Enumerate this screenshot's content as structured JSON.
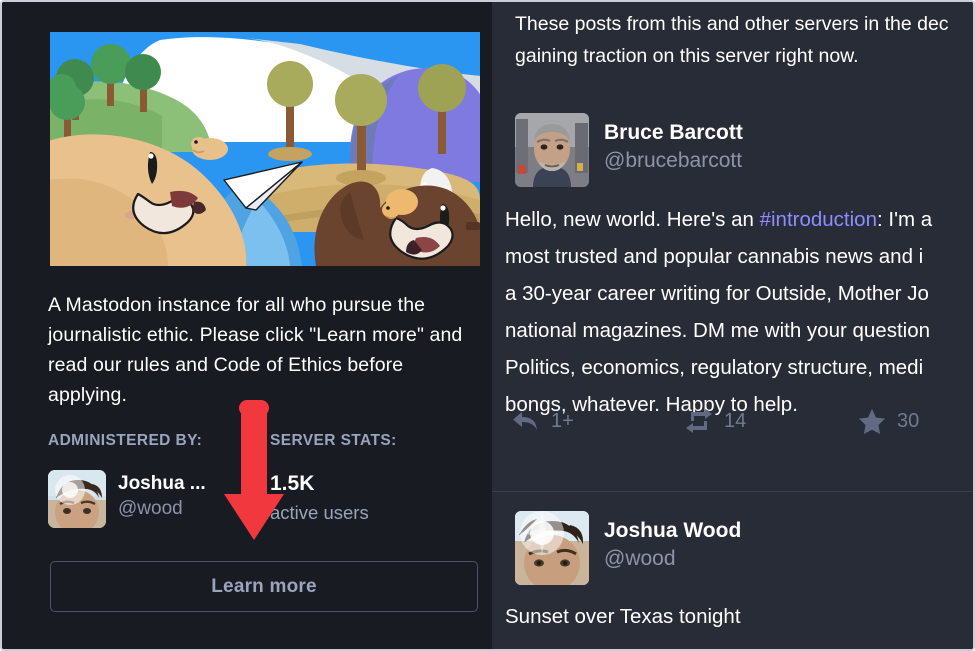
{
  "left_panel": {
    "hero_alt": "mastodon-elephants-illustration",
    "description": "A Mastodon instance for all who pursue the journalistic ethic. Please click \"Learn more\" and read our rules and Code of Ethics before applying.",
    "administered_by_label": "ADMINISTERED BY:",
    "server_stats_label": "SERVER STATS:",
    "admin": {
      "display_name": "Joshua ...",
      "handle": "@wood"
    },
    "stats": {
      "value": "1.5K",
      "label": "active users"
    },
    "learn_more_label": "Learn more"
  },
  "annotation": {
    "type": "arrow",
    "direction": "down",
    "color": "#f2383f",
    "points_to": "Learn more"
  },
  "right_panel": {
    "intro_line_1": "These posts from this and other servers in the dec",
    "intro_line_2": "gaining traction on this server right now.",
    "posts": [
      {
        "display_name": "Bruce Barcott",
        "handle": "@brucebarcott",
        "avatar": "man-with-grey-beard-city-street",
        "body_lines": [
          {
            "pre": "Hello, new world. Here's an ",
            "tag": "#introduction",
            "post": ": I'm a"
          },
          {
            "pre": "most trusted and popular cannabis news and i",
            "tag": "",
            "post": ""
          },
          {
            "pre": "a 30-year career writing for Outside, Mother Jo",
            "tag": "",
            "post": ""
          },
          {
            "pre": "national magazines. DM me with your question",
            "tag": "",
            "post": ""
          },
          {
            "pre": "Politics, economics, regulatory structure, medi",
            "tag": "",
            "post": ""
          },
          {
            "pre": "bongs, whatever. Happy to help.",
            "tag": "",
            "post": ""
          }
        ],
        "actions": [
          {
            "icon": "reply-icon",
            "count": "1+"
          },
          {
            "icon": "boost-icon",
            "count": "14"
          },
          {
            "icon": "favourite-star-icon",
            "count": "30"
          }
        ]
      },
      {
        "display_name": "Joshua Wood",
        "handle": "@wood",
        "avatar": "man-backlit-by-sun",
        "body_lines": [
          {
            "pre": "Sunset over Texas tonight",
            "tag": "",
            "post": ""
          }
        ],
        "actions": []
      }
    ]
  },
  "colors": {
    "left_bg": "#191b22",
    "right_bg": "#282c37",
    "accent_link": "#8c8dff",
    "muted_text": "#9aa4bd",
    "annotation_red": "#f2383f"
  }
}
